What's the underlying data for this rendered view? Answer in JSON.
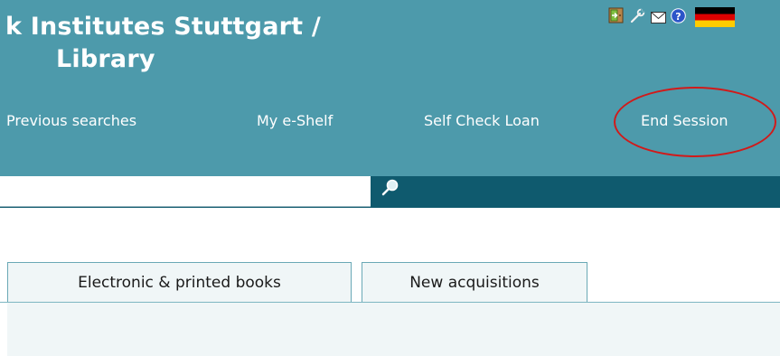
{
  "header": {
    "title_line1": "k Institutes Stuttgart /",
    "title_line2": "Library",
    "icons": [
      "door-icon",
      "wrench-icon",
      "mail-icon",
      "help-icon",
      "german-flag-icon"
    ],
    "background_color": "#4d9aab"
  },
  "nav": {
    "items": [
      {
        "label": "Previous searches"
      },
      {
        "label": "My e-Shelf"
      },
      {
        "label": "Self Check Loan"
      },
      {
        "label": "End Session"
      }
    ],
    "highlight_color": "#d11a1a"
  },
  "search": {
    "value": "",
    "button_icon": "magnifier-icon",
    "bar_color": "#0f5a6e"
  },
  "tabs": [
    {
      "label": "Electronic & printed books"
    },
    {
      "label": "New acquisitions"
    }
  ]
}
